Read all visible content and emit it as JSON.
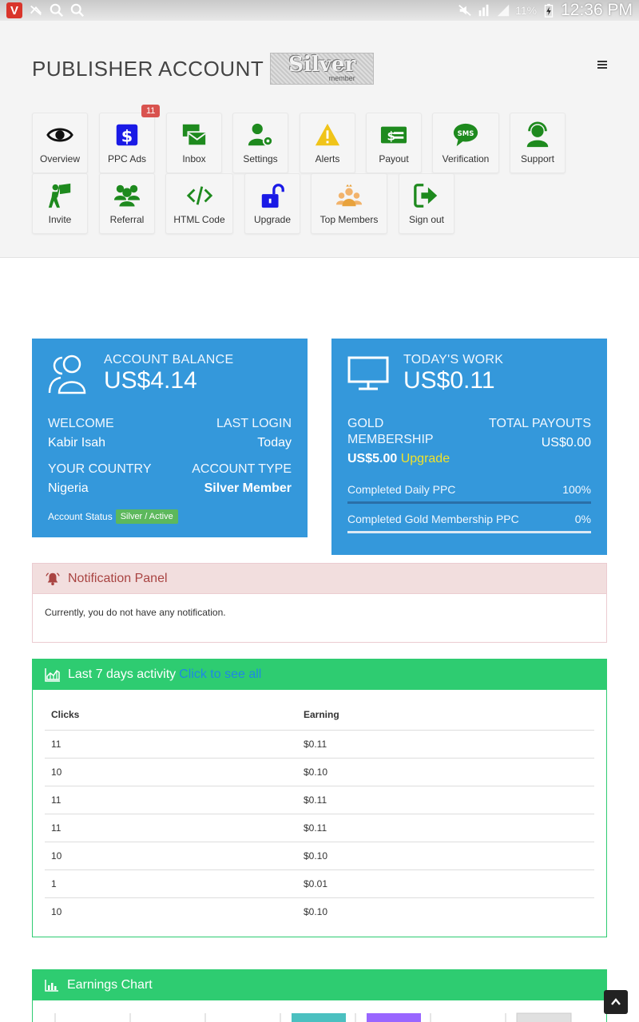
{
  "status_bar": {
    "time": "12:36 PM",
    "battery": "11%",
    "app_icon_letter": "V"
  },
  "header": {
    "title": "PUBLISHER ACCOUNT",
    "badge_text": "Silver",
    "badge_subtext": "member"
  },
  "nav": {
    "overview": "Overview",
    "ppc_ads": "PPC Ads",
    "ppc_ads_count": "11",
    "inbox": "Inbox",
    "settings": "Settings",
    "alerts": "Alerts",
    "payout": "Payout",
    "verification": "Verification",
    "support": "Support",
    "invite": "Invite",
    "referral": "Referral",
    "html_code": "HTML Code",
    "upgrade": "Upgrade",
    "top_members": "Top Members",
    "sign_out": "Sign out"
  },
  "account_box": {
    "label": "ACCOUNT BALANCE",
    "balance": "US$4.14",
    "welcome_label": "WELCOME",
    "welcome_value": "Kabir Isah",
    "last_login_label": "LAST LOGIN",
    "last_login_value": "Today",
    "country_label": "YOUR COUNTRY",
    "country_value": "Nigeria",
    "type_label": "ACCOUNT TYPE",
    "type_value": "Silver Member",
    "status_label": "Account Status",
    "status_value": "Silver / Active"
  },
  "work_box": {
    "label": "TODAY'S WORK",
    "amount": "US$0.11",
    "gold_label_1": "GOLD",
    "gold_label_2": "MEMBERSHIP",
    "gold_price": "US$5.00",
    "upgrade_link": "Upgrade",
    "payouts_label": "TOTAL PAYOUTS",
    "payouts_value": "US$0.00",
    "progress_1_label": "Completed Daily PPC",
    "progress_1_value": "100%",
    "progress_1_fraction": 1.0,
    "progress_2_label": "Completed Gold Membership PPC",
    "progress_2_value": "0%",
    "progress_2_fraction": 0.0
  },
  "notification_panel": {
    "title": "Notification Panel",
    "message": "Currently, you do not have any notification."
  },
  "activity_panel": {
    "title": "Last 7 days activity",
    "see_all": "Click to see all",
    "col_clicks": "Clicks",
    "col_earning": "Earning",
    "rows": [
      {
        "clicks": "11",
        "earning": "$0.11"
      },
      {
        "clicks": "10",
        "earning": "$0.10"
      },
      {
        "clicks": "11",
        "earning": "$0.11"
      },
      {
        "clicks": "11",
        "earning": "$0.11"
      },
      {
        "clicks": "10",
        "earning": "$0.10"
      },
      {
        "clicks": "1",
        "earning": "$0.01"
      },
      {
        "clicks": "10",
        "earning": "$0.10"
      }
    ]
  },
  "earnings_panel": {
    "title": "Earnings Chart"
  },
  "colors": {
    "primary_blue": "#3498db",
    "green": "#2ecc71",
    "danger": "#a94442",
    "nav_green": "#1e8a1e",
    "nav_blue": "#1a1ae6"
  }
}
